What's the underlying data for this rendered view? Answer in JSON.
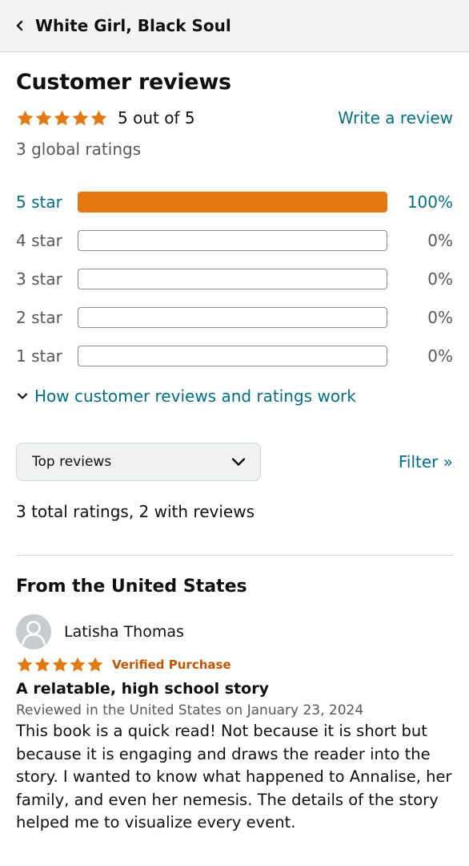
{
  "header": {
    "back_icon": "chevron-left-icon",
    "title": "White Girl, Black Soul"
  },
  "summary": {
    "title": "Customer reviews",
    "rating": 5,
    "rating_text": "5 out of 5",
    "write_review": "Write a review",
    "global_ratings": "3 global ratings",
    "star_color": "#e47911"
  },
  "histogram": [
    {
      "label": "5 star",
      "percent_text": "100%",
      "percent": 100,
      "active": true
    },
    {
      "label": "4 star",
      "percent_text": "0%",
      "percent": 0,
      "active": false
    },
    {
      "label": "3 star",
      "percent_text": "0%",
      "percent": 0,
      "active": false
    },
    {
      "label": "2 star",
      "percent_text": "0%",
      "percent": 0,
      "active": false
    },
    {
      "label": "1 star",
      "percent_text": "0%",
      "percent": 0,
      "active": false
    }
  ],
  "how_link": {
    "icon": "chevron-down-icon",
    "label": "How customer reviews and ratings work"
  },
  "sort": {
    "selected": "Top reviews",
    "icon": "chevron-down-icon"
  },
  "filter_label": "Filter »",
  "totals": "3 total ratings, 2 with reviews",
  "region_title": "From the United States",
  "reviews": [
    {
      "reviewer": "Latisha Thomas",
      "avatar_icon": "user-avatar-icon",
      "rating": 5,
      "verified": "Verified Purchase",
      "title": "A relatable, high school story",
      "date": "Reviewed in the United States on January 23, 2024",
      "body": "This book is a quick read! Not because it is short but because it is engaging and draws the reader into the story. I wanted to know what happened to Annalise, her family, and even her nemesis. The details of the story helped me to visualize every event."
    }
  ]
}
